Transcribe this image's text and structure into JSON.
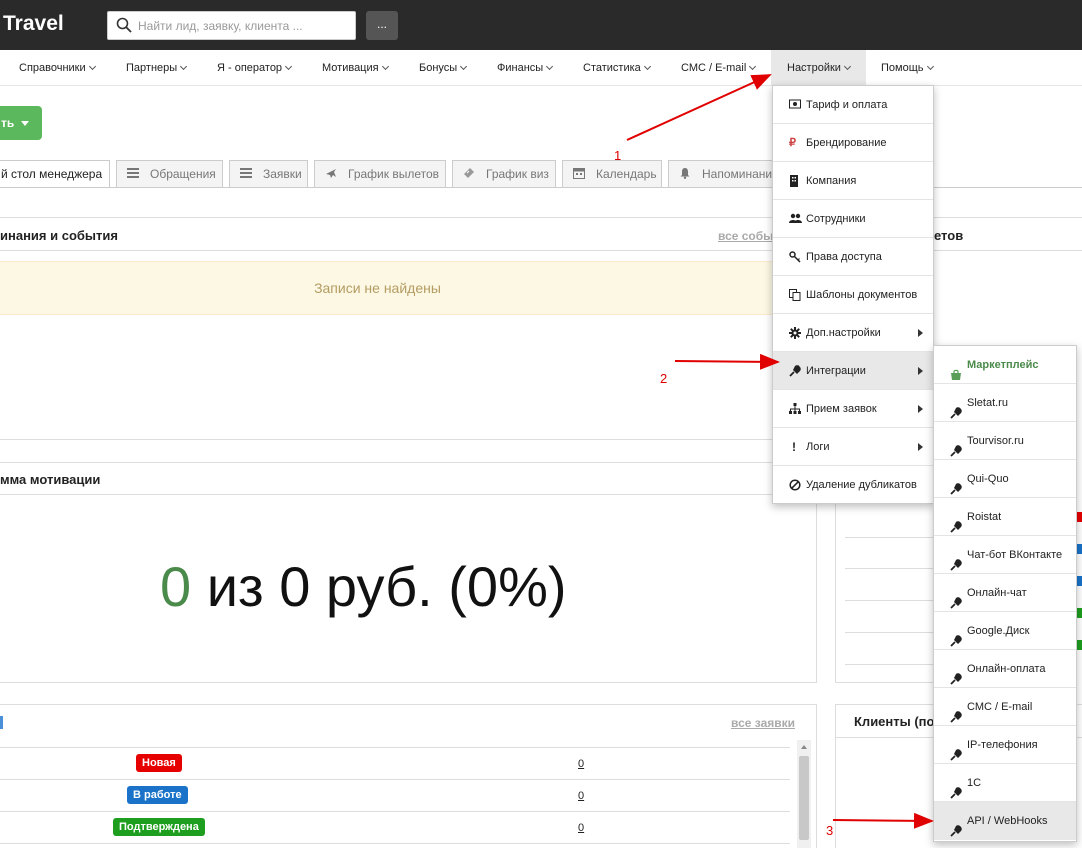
{
  "brand": "Travel",
  "search": {
    "placeholder": "Найти лид, заявку, клиента ...",
    "button": "..."
  },
  "nav": [
    {
      "label": "Справочники"
    },
    {
      "label": "Партнеры"
    },
    {
      "label": "Я - оператор"
    },
    {
      "label": "Мотивация"
    },
    {
      "label": "Бонусы"
    },
    {
      "label": "Финансы"
    },
    {
      "label": "Статистика"
    },
    {
      "label": "СМС / E-mail"
    },
    {
      "label": "Настройки"
    },
    {
      "label": "Помощь"
    }
  ],
  "add_button": {
    "label": "ть"
  },
  "tabs": [
    {
      "label": "й стол менеджера",
      "icon": "none"
    },
    {
      "label": "Обращения",
      "icon": "list-icon"
    },
    {
      "label": "Заявки",
      "icon": "list-icon"
    },
    {
      "label": "График вылетов",
      "icon": "plane-icon"
    },
    {
      "label": "График виз",
      "icon": "ticket-icon"
    },
    {
      "label": "Календарь",
      "icon": "calendar-icon"
    },
    {
      "label": "Напоминани",
      "icon": "bell-icon"
    }
  ],
  "reminders": {
    "title": "инания и события",
    "all_link": "все собы",
    "empty": "Записи не найдены"
  },
  "right_title_partial": "етов",
  "motivation": {
    "title": "мма мотивации",
    "zero": "0",
    "rest": " из 0 руб. (0%)"
  },
  "orders": {
    "all_link": "все заявки",
    "rows": [
      {
        "status": "Новая",
        "color": "#e60000",
        "count": "0"
      },
      {
        "status": "В работе",
        "color": "#1a73c9",
        "count": "0"
      },
      {
        "status": "Подтверждена",
        "color": "#1e9e1e",
        "count": "0"
      }
    ]
  },
  "clients": {
    "title": "Клиенты (по"
  },
  "settings_menu": [
    {
      "label": "Тариф и оплата",
      "icon": "money-icon",
      "sub": false
    },
    {
      "label": "Брендирование",
      "icon": "ruble-icon",
      "sub": false
    },
    {
      "label": "Компания",
      "icon": "building-icon",
      "sub": false
    },
    {
      "label": "Сотрудники",
      "icon": "users-icon",
      "sub": false
    },
    {
      "label": "Права доступа",
      "icon": "key-icon",
      "sub": false
    },
    {
      "label": "Шаблоны документов",
      "icon": "copy-icon",
      "sub": false
    },
    {
      "label": "Доп.настройки",
      "icon": "gear-icon",
      "sub": true
    },
    {
      "label": "Интеграции",
      "icon": "plug-icon",
      "sub": true
    },
    {
      "label": "Прием заявок",
      "icon": "sitemap-icon",
      "sub": true
    },
    {
      "label": "Логи",
      "icon": "exclamation-icon",
      "sub": true
    },
    {
      "label": "Удаление дубликатов",
      "icon": "ban-icon",
      "sub": false
    }
  ],
  "integrations_menu": [
    {
      "label": "Маркетплейс",
      "icon": "bag-icon"
    },
    {
      "label": "Sletat.ru",
      "icon": "plug-icon"
    },
    {
      "label": "Tourvisor.ru",
      "icon": "plug-icon"
    },
    {
      "label": "Qui-Quo",
      "icon": "plug-icon"
    },
    {
      "label": "Roistat",
      "icon": "plug-icon"
    },
    {
      "label": "Чат-бот ВКонтакте",
      "icon": "plug-icon"
    },
    {
      "label": "Онлайн-чат",
      "icon": "plug-icon"
    },
    {
      "label": "Google.Диск",
      "icon": "plug-icon"
    },
    {
      "label": "Онлайн-оплата",
      "icon": "plug-icon"
    },
    {
      "label": "СМС / E-mail",
      "icon": "plug-icon"
    },
    {
      "label": "IP-телефония",
      "icon": "plug-icon"
    },
    {
      "label": "1С",
      "icon": "plug-icon"
    },
    {
      "label": "API / WebHooks",
      "icon": "plug-icon"
    }
  ],
  "annotations": [
    "1",
    "2",
    "3"
  ],
  "colors": {
    "accent_green": "#5cb85c",
    "topbar": "#2a2a2a",
    "arrow_red": "#e00000"
  }
}
